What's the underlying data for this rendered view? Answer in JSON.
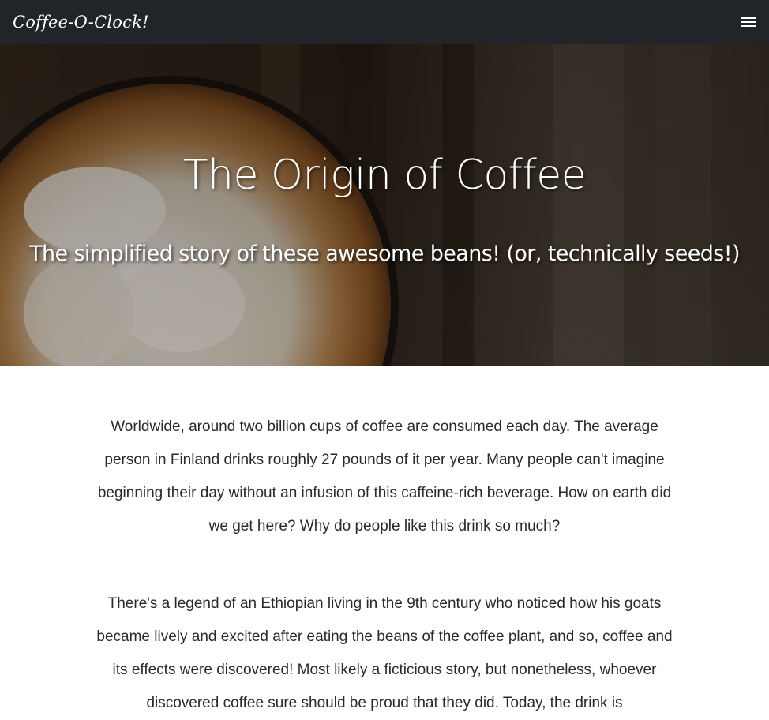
{
  "nav": {
    "brand": "Coffee-O-Clock!",
    "menu_icon": "hamburger-menu-icon"
  },
  "hero": {
    "title": "The Origin of Coffee",
    "subtitle": "The simplified story of these awesome beans! (or, technically seeds!)"
  },
  "content": {
    "paragraphs": [
      "Worldwide, around two billion cups of coffee are consumed each day. The average person in Finland drinks roughly 27 pounds of it per year. Many people can't imagine beginning their day without an infusion of this caffeine-rich beverage. How on earth did we get here? Why do people like this drink so much?",
      "There's a legend of an Ethiopian living in the 9th century who noticed how his goats became lively and excited after eating the beans of the coffee plant, and so, coffee and its effects were discovered! Most likely a ficticious story, but nonetheless, whoever discovered coffee sure should be proud that they did. Today, the drink is"
    ]
  },
  "colors": {
    "navbar_bg": "#212529",
    "text": "#2a2a2a"
  }
}
